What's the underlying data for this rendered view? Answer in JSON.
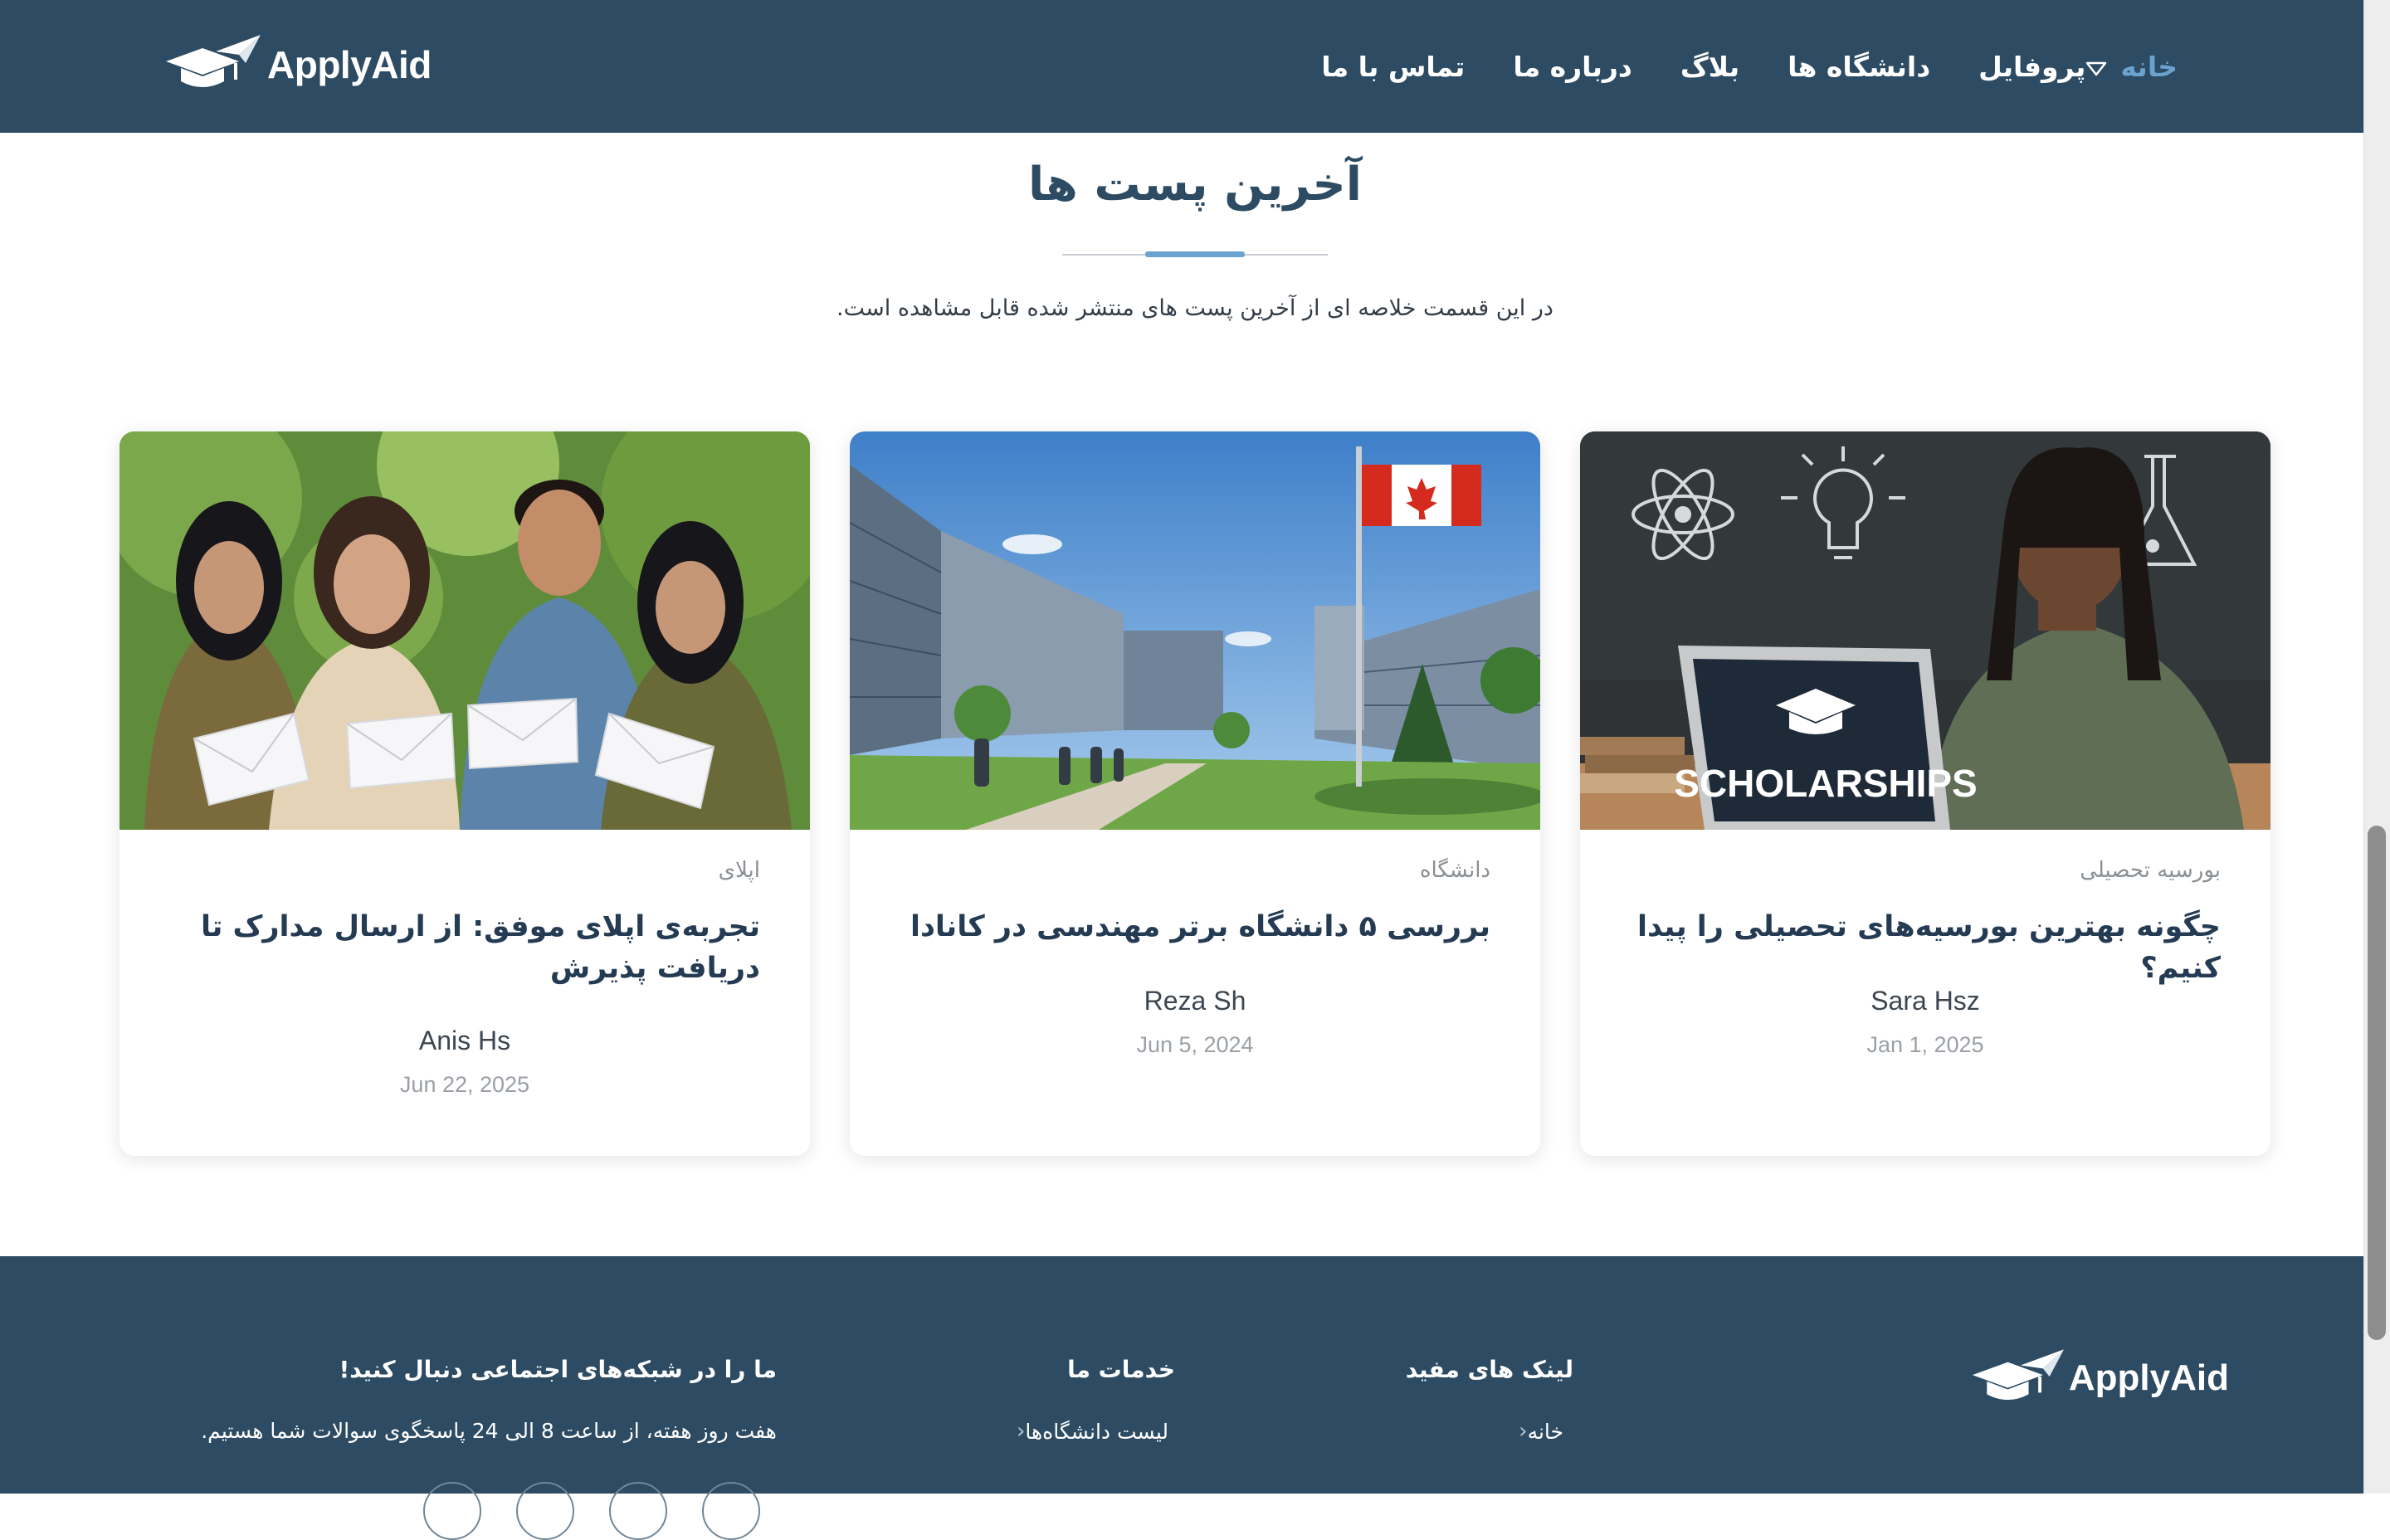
{
  "brand": {
    "name": "ApplyAid",
    "logo_icon": "graduation-cap-plane-icon"
  },
  "nav": {
    "items": [
      {
        "label": "خانه",
        "active": true
      },
      {
        "label": "پروفایل",
        "has_dropdown": true
      },
      {
        "label": "دانشگاه ها"
      },
      {
        "label": "بلاگ"
      },
      {
        "label": "درباره ما"
      },
      {
        "label": "تماس با ما"
      }
    ]
  },
  "section": {
    "title": "آخرین پست ها",
    "subtitle": "در این قسمت خلاصه ای از آخرین پست های منتشر شده قابل مشاهده است."
  },
  "posts": [
    {
      "category": "بورسیه تحصیلی",
      "title": "چگونه بهترین بورسیه‌های تحصیلی را پیدا کنیم؟",
      "author": "Sara Hsz",
      "date": "Jan 1, 2025",
      "image_text": "SCHOLARSHIPS"
    },
    {
      "category": "دانشگاه",
      "title": "بررسی ۵ دانشگاه برتر مهندسی در کانادا",
      "author": "Reza Sh",
      "date": "Jun 5, 2024"
    },
    {
      "category": "اپلای",
      "title": "تجربه‌ی اپلای موفق: از ارسال مدارک تا دریافت پذیرش",
      "author": "Anis Hs",
      "date": "Jun 22, 2025"
    }
  ],
  "footer": {
    "brand": "ApplyAid",
    "useful_links": {
      "heading": "لینک های مفید",
      "items": [
        "خانه"
      ]
    },
    "services": {
      "heading": "خدمات ما",
      "items": [
        "لیست دانشگاه‌ها"
      ]
    },
    "social": {
      "heading": "ما را در شبکه‌های اجتماعی دنبال کنید!",
      "hours": "هفت روز هفته، از ساعت 8 الی 24 پاسخگوی سوالات شما هستیم."
    }
  },
  "colors": {
    "nav_bg": "#2d4b62",
    "accent": "#6aa3cf",
    "heading": "#2d4b62",
    "muted": "#8a8f94"
  }
}
